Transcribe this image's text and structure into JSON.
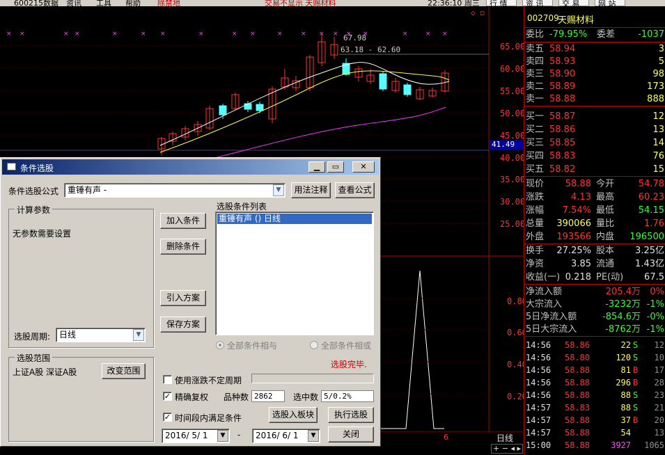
{
  "top": {
    "date_text": "600215数据",
    "menu": [
      "资讯",
      "工具",
      "帮助"
    ],
    "alert": "除禁地",
    "news": "交易不显示   天赐材料",
    "time": "22:36:10 周三",
    "buttons": [
      "行",
      "情",
      "资",
      "讯",
      "交",
      "易",
      "网",
      "站"
    ]
  },
  "chart": {
    "annot_high": "67.98",
    "annot_range": "63.18 - 62.60",
    "current_price": "41.49",
    "price_axis": [
      "65.00",
      "60.00",
      "55.00",
      "50.00",
      "45.00",
      "40.00",
      "35.00",
      "30.00",
      "25.00"
    ],
    "vol_axis": [
      "0.80",
      "0.60",
      "0.40",
      "0.20"
    ],
    "vol_x_label": "6",
    "period_label": "日线",
    "markers": "◇ ◻"
  },
  "stock": {
    "code": "002709",
    "name": "天赐材料",
    "wb_label": "委比",
    "wb_value": "-79.95%",
    "wc_label": "委差",
    "wc_value": "-1037",
    "asks": [
      {
        "label": "卖五",
        "price": "58.94",
        "vol": "3"
      },
      {
        "label": "卖四",
        "price": "58.93",
        "vol": "5"
      },
      {
        "label": "卖三",
        "price": "58.90",
        "vol": "98"
      },
      {
        "label": "卖二",
        "price": "58.89",
        "vol": "173"
      },
      {
        "label": "卖一",
        "price": "58.88",
        "vol": "888"
      }
    ],
    "bids": [
      {
        "label": "买一",
        "price": "58.87",
        "vol": "12"
      },
      {
        "label": "买二",
        "price": "58.86",
        "vol": "13"
      },
      {
        "label": "买三",
        "price": "58.85",
        "vol": "14"
      },
      {
        "label": "买四",
        "price": "58.83",
        "vol": "76"
      },
      {
        "label": "买五",
        "price": "58.82",
        "vol": "15"
      }
    ],
    "stats": [
      {
        "l1": "现价",
        "v1": "58.88",
        "c1": "red",
        "l2": "今开",
        "v2": "54.78",
        "c2": "red"
      },
      {
        "l1": "涨跌",
        "v1": "4.13",
        "c1": "red",
        "l2": "最高",
        "v2": "60.23",
        "c2": "red"
      },
      {
        "l1": "涨幅",
        "v1": "7.54%",
        "c1": "red",
        "l2": "最低",
        "v2": "54.15",
        "c2": "grn"
      },
      {
        "l1": "总量",
        "v1": "390066",
        "c1": "yel",
        "l2": "量比",
        "v2": "1.76",
        "c2": "red"
      },
      {
        "l1": "外盘",
        "v1": "193566",
        "c1": "red",
        "l2": "内盘",
        "v2": "196500",
        "c2": "grn"
      }
    ],
    "stats2": [
      {
        "l1": "换手",
        "v1": "27.25%",
        "l2": "股本",
        "v2": "3.25亿"
      },
      {
        "l1": "净资",
        "v1": "3.85",
        "l2": "流通",
        "v2": "1.43亿"
      },
      {
        "l1": "收益(一)",
        "v1": "0.218",
        "l2": "PE(动)",
        "v2": "67.5"
      }
    ],
    "flows": [
      {
        "label": "净流入额",
        "value": "205.4万",
        "vc": "red",
        "pct": "0%",
        "pc": "red"
      },
      {
        "label": "大宗流入",
        "value": "-3232万",
        "vc": "grn",
        "pct": "-1%",
        "pc": "grn"
      },
      {
        "label": "5日净流入额",
        "value": "-854.6万",
        "vc": "grn",
        "pct": "-0%",
        "pc": "grn"
      },
      {
        "label": "5日大宗流入",
        "value": "-8762万",
        "vc": "grn",
        "pct": "-1%",
        "pc": "grn"
      }
    ],
    "ticks": [
      {
        "time": "14:56",
        "price": "58.86",
        "vol": "22",
        "vc": "yel",
        "side": "S",
        "sc": "grn",
        "num": "12"
      },
      {
        "time": "14:56",
        "price": "58.80",
        "vol": "120",
        "vc": "yel",
        "side": "S",
        "sc": "grn",
        "num": "10"
      },
      {
        "time": "14:56",
        "price": "58.88",
        "vol": "81",
        "vc": "yel",
        "side": "B",
        "sc": "red",
        "num": "17"
      },
      {
        "time": "14:56",
        "price": "58.88",
        "vol": "296",
        "vc": "yel",
        "side": "B",
        "sc": "red",
        "num": "28"
      },
      {
        "time": "14:56",
        "price": "58.88",
        "vol": "88",
        "vc": "yel",
        "side": "S",
        "sc": "grn",
        "num": "23"
      },
      {
        "time": "14:57",
        "price": "58.83",
        "vol": "88",
        "vc": "yel",
        "side": "S",
        "sc": "grn",
        "num": "21"
      },
      {
        "time": "14:57",
        "price": "58.88",
        "vol": "37",
        "vc": "yel",
        "side": "B",
        "sc": "red",
        "num": "20"
      },
      {
        "time": "14:57",
        "price": "58.88",
        "vol": "54",
        "vc": "yel",
        "side": "",
        "sc": "grn",
        "num": "13"
      },
      {
        "time": "15:00",
        "price": "58.88",
        "vol": "3927",
        "vc": "mag",
        "side": "",
        "sc": "grn",
        "num": "1065"
      }
    ]
  },
  "dialog": {
    "title": "条件选股",
    "formula_label": "条件选股公式",
    "formula_value": "重锤有声 -",
    "usage_button": "用法注释",
    "view_button": "查看公式",
    "params_group": "计算参数",
    "params_text": "无参数需要设置",
    "period_label": "选股周期:",
    "period_value": "日线",
    "range_group": "选股范围",
    "range_text": "上证A股 深证A股",
    "change_range_button": "改变范围",
    "add_button": "加入条件",
    "delete_button": "删除条件",
    "import_button": "引入方案",
    "save_button": "保存方案",
    "list_label": "选股条件列表",
    "list_items": [
      "重锤有声  () 日线"
    ],
    "radio_and": "全部条件相与",
    "radio_or": "全部条件相或",
    "status": "选股完毕.",
    "chk_variable": "使用涨跌不定周期",
    "chk_precise": "精确复权",
    "varieties_label": "品种数",
    "varieties_value": "2862",
    "selected_label": "选中数",
    "selected_value": "5/0.2%",
    "chk_period": "时间段内满足条件",
    "into_block_button": "选股入板块",
    "run_button": "执行选股",
    "date_from": "2016/ 5/ 1",
    "date_to": "2016/ 6/ 1",
    "dash": "-",
    "close_button": "关闭"
  }
}
